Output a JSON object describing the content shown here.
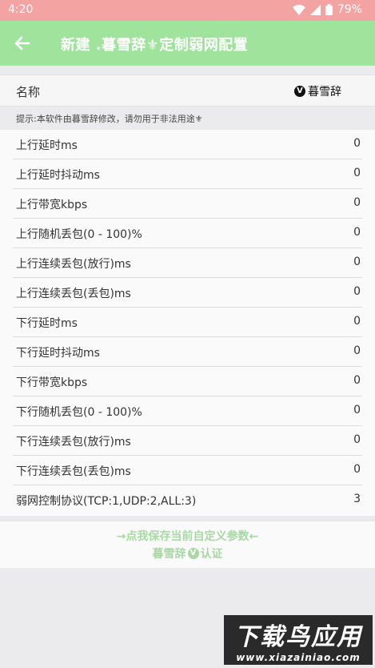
{
  "status_bar": {
    "time": "4:20",
    "battery": "79%"
  },
  "app_bar": {
    "title": "新建    .暮雪辞⚜定制弱网配置"
  },
  "name_row": {
    "label": "名称",
    "value": "暮雪辞",
    "badge": "V"
  },
  "hint": "提示:本软件由暮雪辞修改，请勿用于非法用途⚜",
  "settings": [
    {
      "label": "上行延时ms",
      "value": "0"
    },
    {
      "label": "上行延时抖动ms",
      "value": "0"
    },
    {
      "label": "上行带宽kbps",
      "value": "0"
    },
    {
      "label": "上行随机丢包(0 - 100)%",
      "value": "0"
    },
    {
      "label": "上行连续丢包(放行)ms",
      "value": "0"
    },
    {
      "label": "上行连续丢包(丢包)ms",
      "value": "0"
    },
    {
      "label": "下行延时ms",
      "value": "0"
    },
    {
      "label": "下行延时抖动ms",
      "value": "0"
    },
    {
      "label": "下行带宽kbps",
      "value": "0"
    },
    {
      "label": "下行随机丢包(0 - 100)%",
      "value": "0"
    },
    {
      "label": "下行连续丢包(放行)ms",
      "value": "0"
    },
    {
      "label": "下行连续丢包(丢包)ms",
      "value": "0"
    },
    {
      "label": "弱网控制协议(TCP:1,UDP:2,ALL:3)",
      "value": "3"
    }
  ],
  "save": {
    "label": "→点我保存当前自定义参数←",
    "verify_prefix": "暮雪辞",
    "verify_badge": "V",
    "verify_suffix": "认证"
  },
  "watermark": {
    "big": "下载鸟应用",
    "small": "www.xiazainiao.com"
  },
  "colors": {
    "status_bar": "#f4a3a3",
    "app_bar": "#9fe39c",
    "accent_text": "#a8d8a4"
  }
}
